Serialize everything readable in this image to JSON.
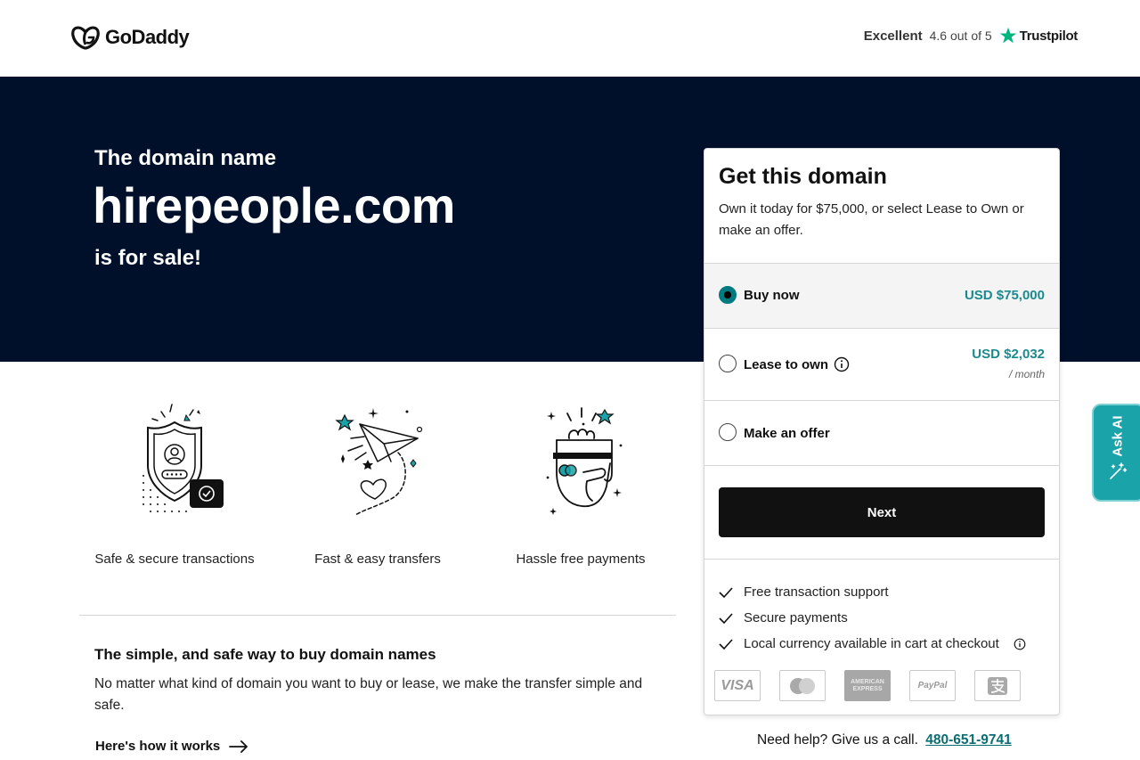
{
  "header": {
    "logo_text": "GoDaddy",
    "trust_excellent": "Excellent",
    "trust_rating": "4.6 out of 5",
    "trust_brand": "Trustpilot"
  },
  "hero": {
    "pre": "The domain name",
    "domain": "hirepeople.com",
    "post": "is for sale!"
  },
  "features": [
    {
      "label": "Safe & secure transactions",
      "icon": "shield-icon"
    },
    {
      "label": "Fast & easy transfers",
      "icon": "paper-plane-icon"
    },
    {
      "label": "Hassle free payments",
      "icon": "card-hand-icon"
    }
  ],
  "info": {
    "title": "The simple, and safe way to buy domain names",
    "body": "No matter what kind of domain you want to buy or lease, we make the transfer simple and safe.",
    "link": "Here's how it works"
  },
  "card": {
    "title": "Get this domain",
    "description": "Own it today for $75,000, or select Lease to Own or make an offer.",
    "options": {
      "buy": {
        "label": "Buy now",
        "price": "USD $75,000",
        "selected": true
      },
      "lease": {
        "label": "Lease to own",
        "price": "USD $2,032",
        "sub": "/ month",
        "selected": false
      },
      "offer": {
        "label": "Make an offer",
        "selected": false
      }
    },
    "next_label": "Next",
    "benefits": [
      "Free transaction support",
      "Secure payments",
      "Local currency available in cart at checkout"
    ],
    "payments": [
      "VISA",
      "Mastercard",
      "AMERICAN EXPRESS",
      "PayPal",
      "Alipay"
    ]
  },
  "help": {
    "text": "Need help? Give us a call.",
    "phone": "480-651-9741"
  },
  "askai": {
    "label": "Ask AI"
  },
  "colors": {
    "hero_bg": "#000f2a",
    "accent_teal": "#1b8a8f",
    "askai_bg": "#1aa3a8",
    "trustpilot_green": "#00b67a"
  }
}
